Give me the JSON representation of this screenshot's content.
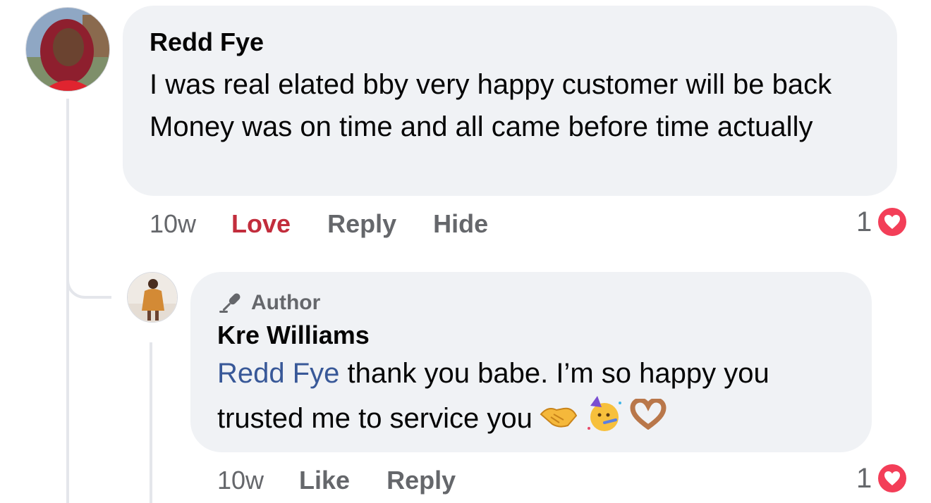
{
  "comments": [
    {
      "author": "Redd Fye",
      "text": "I was real elated bby very happy customer will be back Money was on time and all came before time actually",
      "time": "10w",
      "actions": {
        "reaction_label": "Love",
        "reply": "Reply",
        "hide": "Hide"
      },
      "reaction_count": "1",
      "reaction_icon": "heart-icon"
    }
  ],
  "reply": {
    "badge": "Author",
    "badge_icon": "microphone-icon",
    "author": "Kre Williams",
    "mention": "Redd Fye",
    "text": " thank you babe. I’m so happy you trusted me to service you",
    "emojis": [
      "handshake-emoji",
      "partying-face-emoji",
      "heart-hands-emoji"
    ],
    "time": "10w",
    "actions": {
      "like": "Like",
      "reply": "Reply"
    },
    "reaction_count": "1",
    "reaction_icon": "heart-icon"
  },
  "colors": {
    "bubble_bg": "#f0f2f5",
    "secondary_text": "#65676b",
    "love_red": "#c22d3c",
    "mention_blue": "#385898",
    "heart_badge": "#f33e58"
  }
}
